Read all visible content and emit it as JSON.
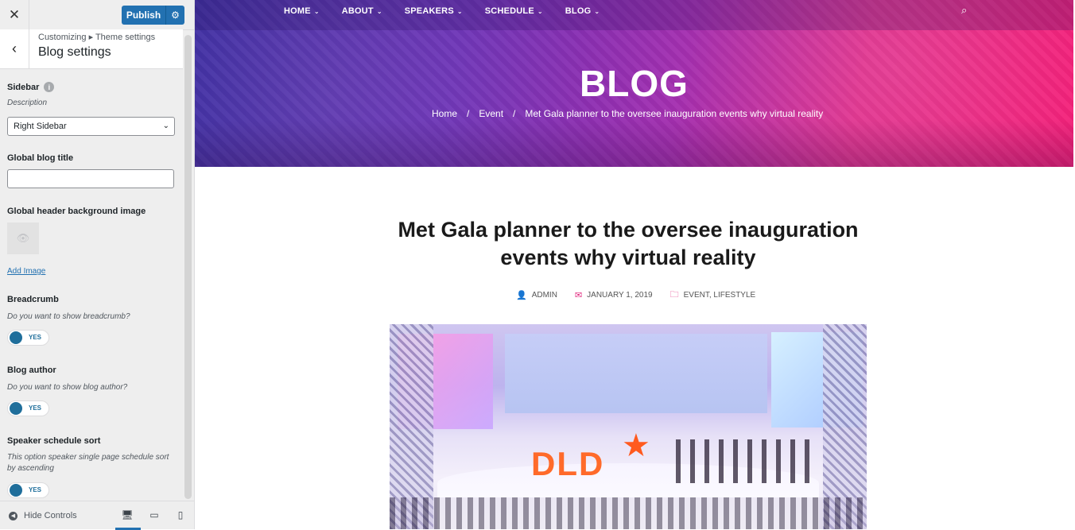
{
  "customizer": {
    "close_icon": "close-icon",
    "publish_label": "Publish",
    "publish_settings_icon": "gear-icon",
    "back_icon": "chevron-left-icon",
    "breadcrumb": "Customizing ▸ Theme settings",
    "section_title": "Blog settings",
    "sidebar": {
      "label": "Sidebar",
      "description": "Description",
      "selected": "Right Sidebar"
    },
    "global_blog_title": {
      "label": "Global blog title",
      "value": ""
    },
    "header_bg": {
      "label": "Global header background image",
      "add_image": "Add Image"
    },
    "breadcrumb_setting": {
      "label": "Breadcrumb",
      "description": "Do you want to show breadcrumb?",
      "toggle": "YES"
    },
    "blog_author": {
      "label": "Blog author",
      "description": "Do you want to show blog author?",
      "toggle": "YES"
    },
    "speaker_sort": {
      "label": "Speaker schedule sort",
      "description": "This option speaker single page schedule sort by ascending",
      "toggle": "YES"
    },
    "footer": {
      "hide_controls": "Hide Controls"
    },
    "accent_color": "#2271b1"
  },
  "preview": {
    "nav": [
      {
        "label": "HOME"
      },
      {
        "label": "ABOUT"
      },
      {
        "label": "SPEAKERS"
      },
      {
        "label": "SCHEDULE"
      },
      {
        "label": "BLOG"
      }
    ],
    "hero_title": "BLOG",
    "breadcrumbs": [
      "Home",
      "/",
      "Event",
      "/",
      "Met Gala planner to the oversee inauguration events why virtual reality"
    ],
    "post_title": "Met Gala planner to the oversee inauguration events why virtual reality",
    "meta": {
      "author": "ADMIN",
      "date": "JANUARY 1, 2019",
      "categories": "EVENT, LIFESTYLE"
    },
    "photo_logo": "DLD",
    "accent_color": "#e0257c"
  }
}
